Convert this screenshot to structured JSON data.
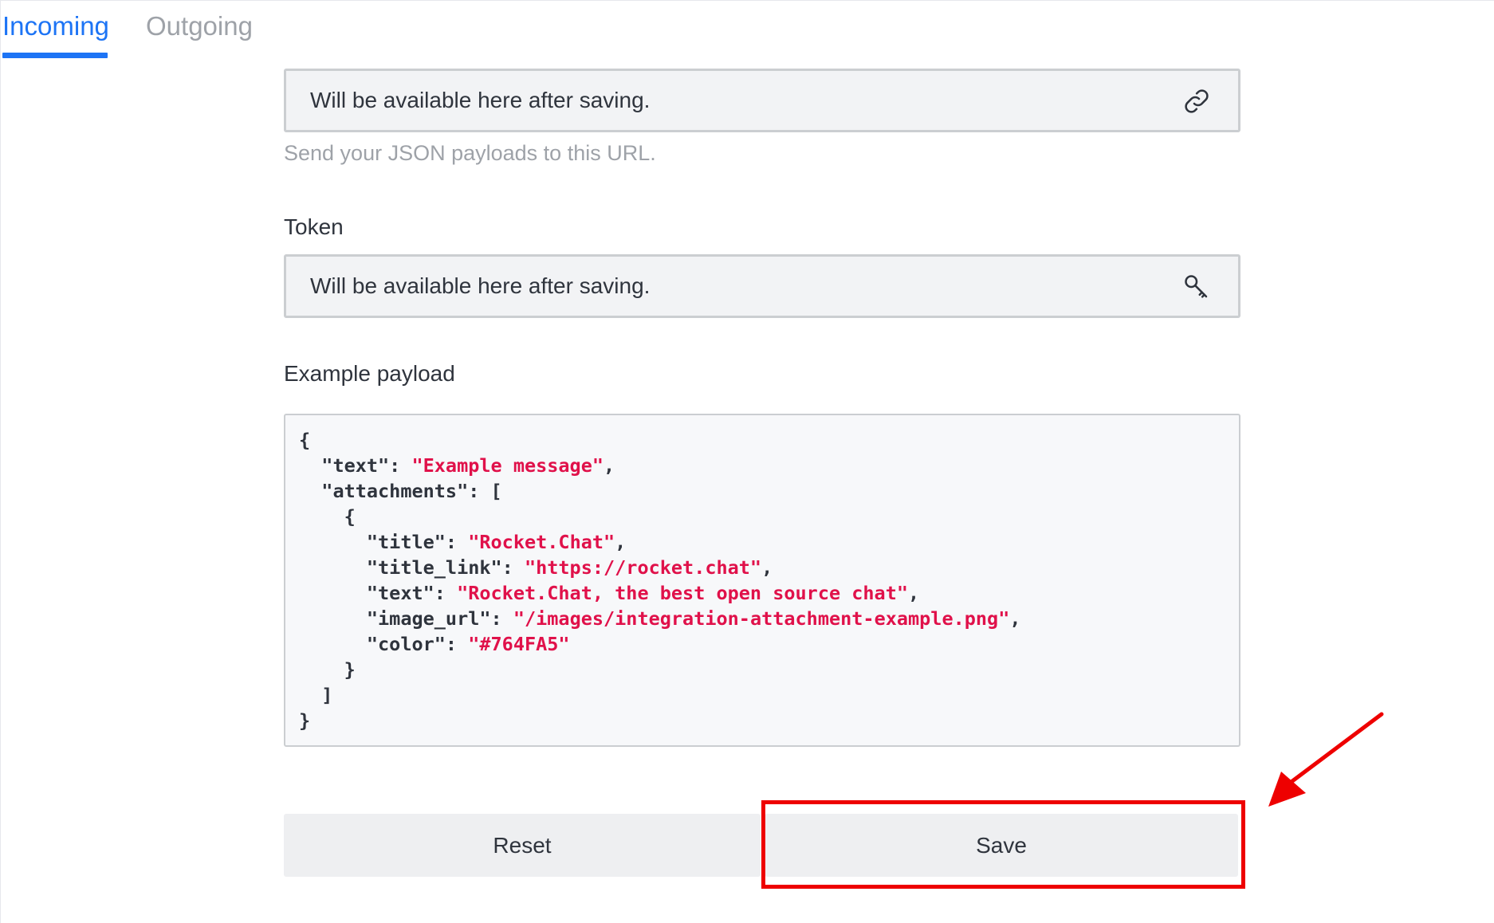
{
  "tabs": [
    {
      "label": "Incoming",
      "active": true
    },
    {
      "label": "Outgoing",
      "active": false
    }
  ],
  "webhook_url": {
    "value": "Will be available here after saving.",
    "hint": "Send your JSON payloads to this URL.",
    "icon": "link-icon"
  },
  "token": {
    "label": "Token",
    "value": "Will be available here after saving.",
    "icon": "key-icon"
  },
  "example_payload": {
    "label": "Example payload",
    "fields": {
      "text": "\"Example message\"",
      "title": "\"Rocket.Chat\"",
      "title_link": "\"https://rocket.chat\"",
      "attachment_text": "\"Rocket.Chat, the best open source chat\"",
      "image_url": "\"/images/integration-attachment-example.png\"",
      "color": "\"#764FA5\""
    }
  },
  "buttons": {
    "reset": "Reset",
    "save": "Save"
  },
  "colors": {
    "accent": "#1d74f5",
    "inactive_tab": "#9ea2a8",
    "code_string": "#e0114a",
    "annotation": "#ee0000"
  }
}
